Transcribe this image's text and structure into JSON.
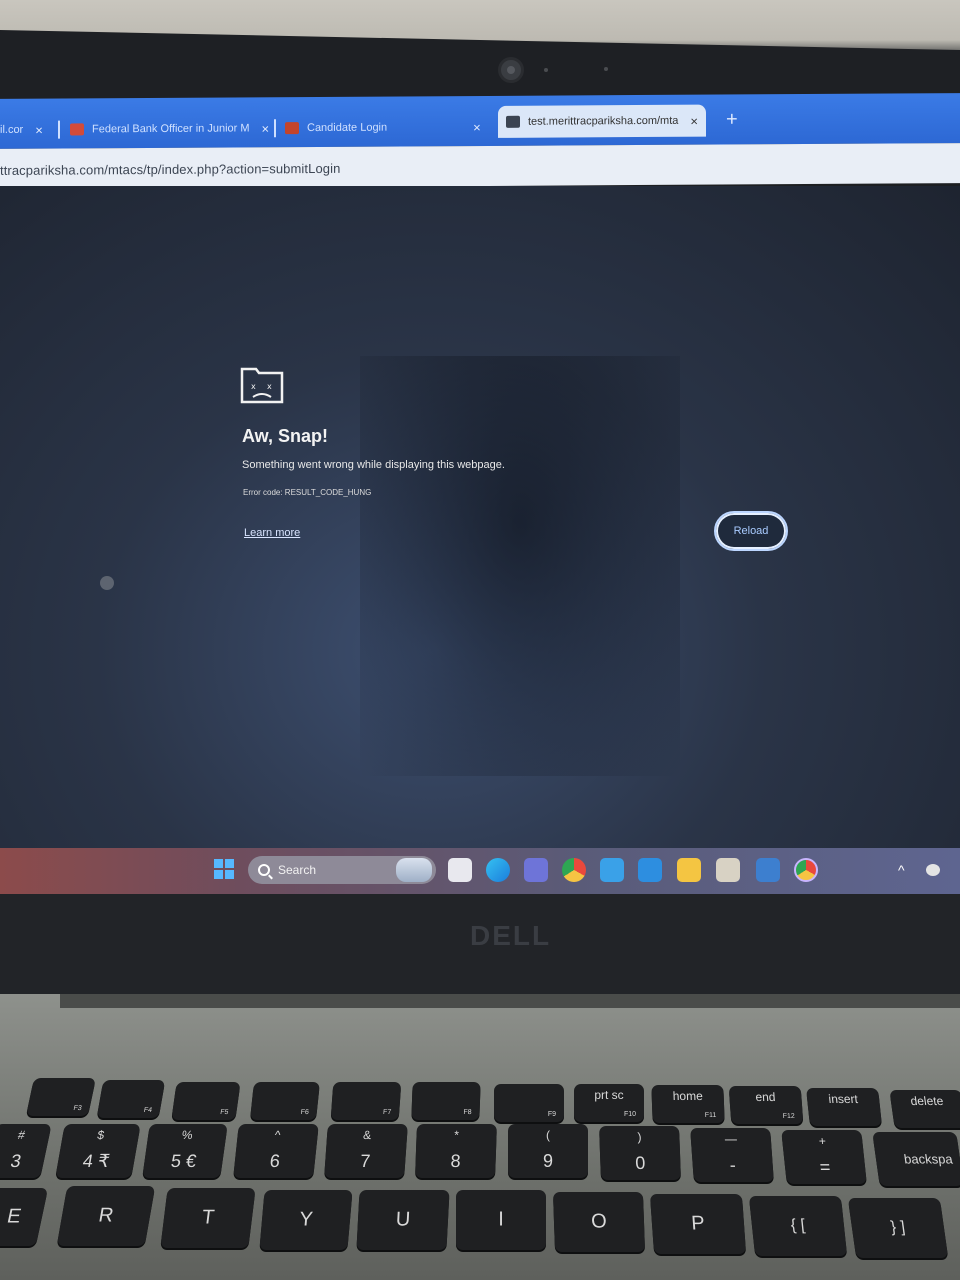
{
  "tabs": [
    {
      "label": "il.cor",
      "close": "×"
    },
    {
      "label": "Federal Bank Officer in Junior M",
      "close": "×"
    },
    {
      "label": "Candidate Login",
      "close": "×"
    },
    {
      "label": "test.merittracpariksha.com/mta",
      "close": "×"
    }
  ],
  "new_tab_symbol": "+",
  "address": {
    "url": "ttracpariksha.com/mtacs/tp/index.php?action=submitLogin"
  },
  "error_page": {
    "title": "Aw, Snap!",
    "message": "Something went wrong while displaying this webpage.",
    "error_code": "Error code: RESULT_CODE_HUNG",
    "learn_more": "Learn more",
    "reload": "Reload"
  },
  "taskbar": {
    "search_placeholder": "Search",
    "pinned": [
      "start-icon",
      "search-box",
      "task-view-icon",
      "edge-icon",
      "teams-icon",
      "chrome-icon",
      "mail-icon",
      "vscode-icon",
      "file-explorer-icon",
      "store-icon",
      "photos-icon",
      "chrome-profile-icon"
    ],
    "tray_chevron": "^"
  },
  "laptop_brand": "DELL",
  "keyboard": {
    "function_row": [
      "F3",
      "F4",
      "F5",
      "F6",
      "F7",
      "F8",
      "F9",
      "prt sc",
      "home",
      "end",
      "insert",
      "delete"
    ],
    "function_sub": [
      "",
      "",
      "",
      "",
      "",
      "",
      "",
      "F10",
      "F11",
      "F12",
      "",
      ""
    ],
    "number_row_top": [
      "#",
      "$",
      "%",
      "^",
      "&",
      "*",
      "(",
      ")",
      "—",
      "+",
      "backspa"
    ],
    "number_row_bottom": [
      "3",
      "4 ₹",
      "5 €",
      "6",
      "7",
      "8",
      "9",
      "0",
      "-",
      "=",
      ""
    ],
    "letter_row": [
      "E",
      "R",
      "T",
      "Y",
      "U",
      "I",
      "O",
      "P",
      "{ [",
      "} ]"
    ]
  }
}
